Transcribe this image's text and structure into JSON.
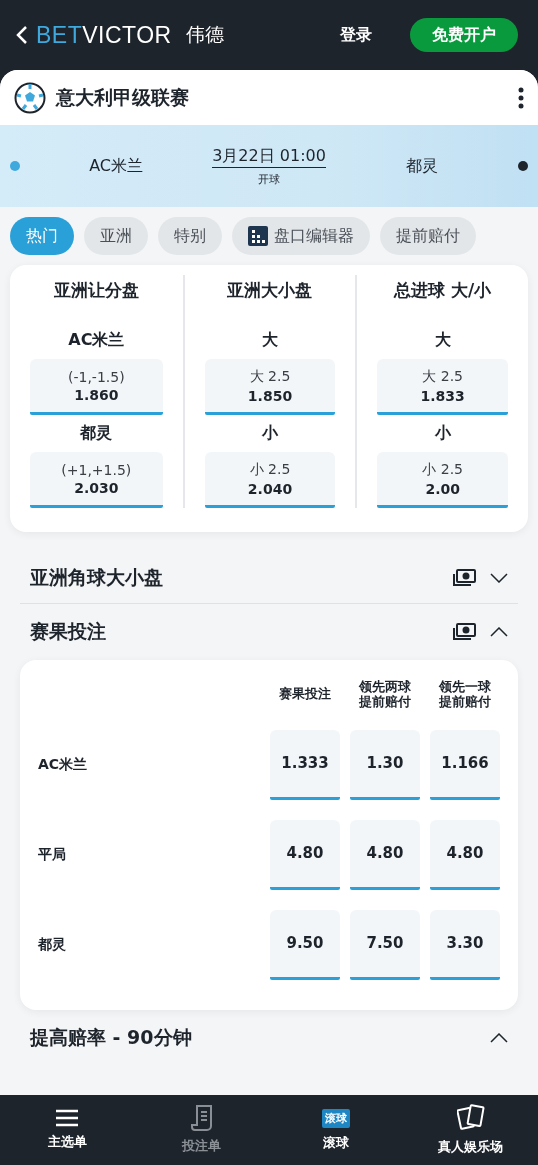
{
  "header": {
    "brand_prefix": "BET",
    "brand_main": "VICTOR",
    "brand_cn": "伟德",
    "login": "登录",
    "signup": "免费开户"
  },
  "league": {
    "title": "意大利甲级联赛"
  },
  "match": {
    "home": {
      "name": "AC米兰",
      "color": "#3fa9de"
    },
    "away": {
      "name": "都灵",
      "color": "#1e242c"
    },
    "time": "3月22日 01:00",
    "status": "开球"
  },
  "tabs": [
    {
      "label": "热门",
      "selected": true,
      "kind": "text"
    },
    {
      "label": "亚洲",
      "selected": false,
      "kind": "text"
    },
    {
      "label": "特别",
      "selected": false,
      "kind": "text"
    },
    {
      "label": "盘口编辑器",
      "selected": false,
      "kind": "icon"
    },
    {
      "label": "提前赔付",
      "selected": false,
      "kind": "text"
    }
  ],
  "markets": [
    {
      "title": "亚洲让分盘",
      "outcomes": [
        {
          "name": "AC米兰",
          "line": "(-1,-1.5)",
          "odds": "1.860"
        },
        {
          "name": "都灵",
          "line": "(+1,+1.5)",
          "odds": "2.030"
        }
      ]
    },
    {
      "title": "亚洲大小盘",
      "outcomes": [
        {
          "name": "大",
          "line": "大 2.5",
          "odds": "1.850"
        },
        {
          "name": "小",
          "line": "小 2.5",
          "odds": "2.040"
        }
      ]
    },
    {
      "title": "总进球 大/小",
      "outcomes": [
        {
          "name": "大",
          "line": "大 2.5",
          "odds": "1.833"
        },
        {
          "name": "小",
          "line": "小 2.5",
          "odds": "2.00"
        }
      ]
    }
  ],
  "sections": [
    {
      "title": "亚洲角球大小盘",
      "expanded": false
    },
    {
      "title": "赛果投注",
      "expanded": true
    }
  ],
  "result_table": {
    "columns": [
      "赛果投注",
      "领先两球提前赔付",
      "领先一球提前赔付"
    ],
    "rows": [
      {
        "label": "AC米兰",
        "odds": [
          "1.333",
          "1.30",
          "1.166"
        ]
      },
      {
        "label": "平局",
        "odds": [
          "4.80",
          "4.80",
          "4.80"
        ]
      },
      {
        "label": "都灵",
        "odds": [
          "9.50",
          "7.50",
          "3.30"
        ]
      }
    ]
  },
  "next_section": {
    "title": "提高赔率 - 90分钟",
    "expanded": true
  },
  "bottom_nav": [
    {
      "label": "主选单",
      "kind": "menu",
      "disabled": false
    },
    {
      "label": "投注单",
      "kind": "slip",
      "disabled": true
    },
    {
      "label": "滚球",
      "kind": "live",
      "badge": "滚球",
      "disabled": false
    },
    {
      "label": "真人娱乐场",
      "kind": "cards",
      "disabled": false
    }
  ]
}
